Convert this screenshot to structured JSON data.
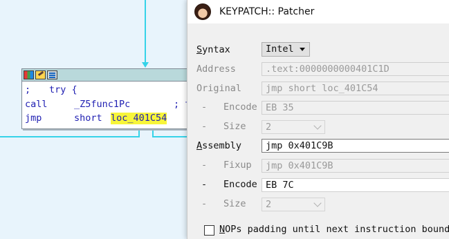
{
  "ida_graph": {
    "node_lines": [
      {
        "col1": ";",
        "col2": "try {",
        "col3": ""
      },
      {
        "col1": "call",
        "col2": "_Z5func1Pc",
        "col3": "; t"
      },
      {
        "col1": "jmp",
        "col2": "short",
        "col3": "loc_401C54"
      }
    ],
    "toolbar_icons": [
      "color-palette-icon",
      "edit-icon",
      "graph-overview-icon"
    ],
    "colors": {
      "edge": "#35d3e8",
      "highlight": "#f7f53a",
      "code_text": "#1f1fb2"
    }
  },
  "dialog": {
    "title": "KEYPATCH:: Patcher",
    "icon": "keypatch-app-icon",
    "syntax": {
      "label_ul": "S",
      "label_rest": "yntax",
      "value": "Intel"
    },
    "address": {
      "label": "Address",
      "value": ".text:0000000000401C1D"
    },
    "original": {
      "label": "Original",
      "value": "jmp short loc_401C54"
    },
    "orig_encode": {
      "dash": "-",
      "label": "Encode",
      "value": "EB 35"
    },
    "orig_size": {
      "dash": "-",
      "label": "Size",
      "value": "2"
    },
    "assembly": {
      "label_ul": "A",
      "label_rest": "ssembly",
      "value": "jmp 0x401C9B"
    },
    "fixup": {
      "dash": "-",
      "label": "Fixup",
      "value": "jmp 0x401C9B"
    },
    "asm_encode": {
      "dash": "-",
      "label": "Encode",
      "value": "EB 7C"
    },
    "asm_size": {
      "dash": "-",
      "label": "Size",
      "value": "2"
    },
    "nops": {
      "label_ul": "N",
      "label_rest": "OPs padding until next instruction bounda",
      "checked": false
    }
  }
}
